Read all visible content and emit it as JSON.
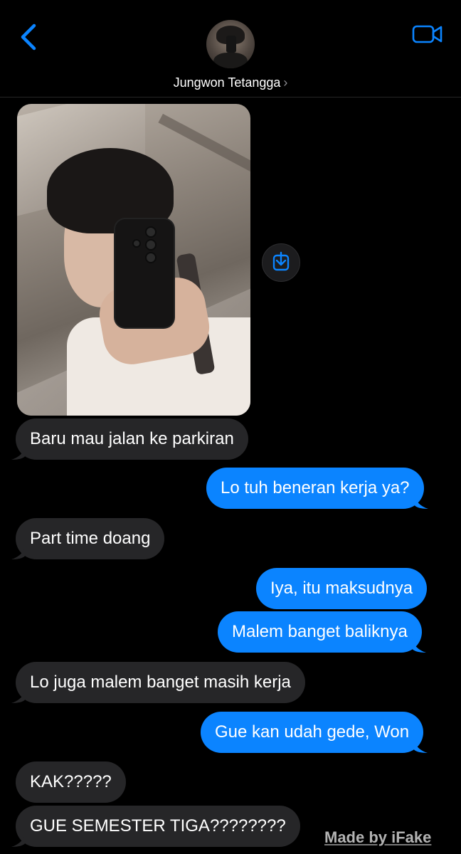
{
  "header": {
    "contact_name": "Jungwon Tetangga",
    "back_icon": "chevron-left-icon",
    "video_icon": "video-camera-icon",
    "accent_color": "#0b84ff"
  },
  "attachment": {
    "type": "photo",
    "save_icon": "download-icon"
  },
  "messages": [
    {
      "direction": "incoming",
      "text": "Baru mau jalan ke parkiran"
    },
    {
      "direction": "outgoing",
      "text": "Lo tuh beneran kerja ya?"
    },
    {
      "direction": "incoming",
      "text": "Part time doang"
    },
    {
      "direction": "outgoing",
      "text": "Iya, itu maksudnya"
    },
    {
      "direction": "outgoing",
      "text": "Malem banget baliknya"
    },
    {
      "direction": "incoming",
      "text": "Lo juga malem banget masih kerja"
    },
    {
      "direction": "outgoing",
      "text": "Gue kan udah gede, Won"
    },
    {
      "direction": "incoming",
      "text": "KAK?????"
    },
    {
      "direction": "incoming",
      "text": "GUE SEMESTER TIGA????????"
    }
  ],
  "colors": {
    "incoming_bubble": "#262628",
    "outgoing_bubble": "#0b84ff",
    "background": "#000000"
  },
  "watermark": "Made by iFake"
}
